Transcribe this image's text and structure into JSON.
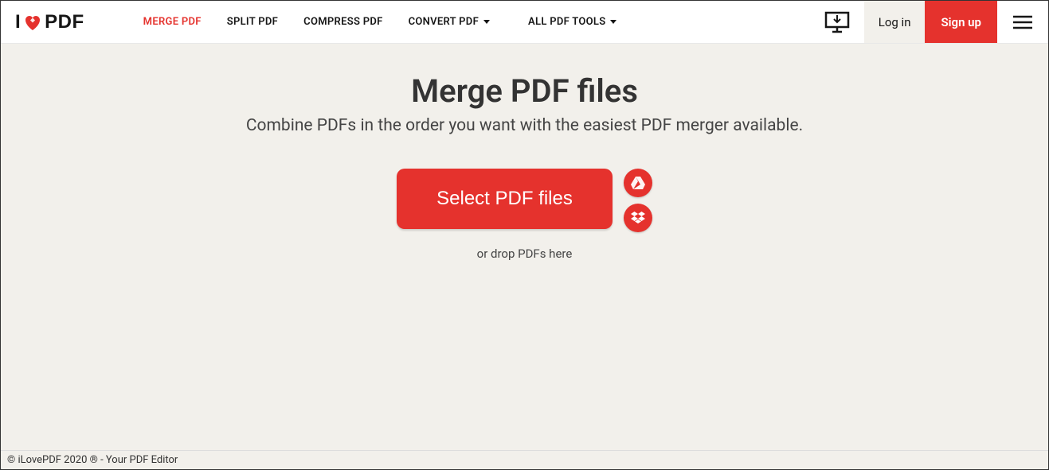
{
  "logo": {
    "prefix": "I",
    "suffix": "PDF"
  },
  "nav": {
    "merge": "MERGE PDF",
    "split": "SPLIT PDF",
    "compress": "COMPRESS PDF",
    "convert": "CONVERT PDF",
    "all": "ALL PDF TOOLS"
  },
  "header": {
    "login": "Log in",
    "signup": "Sign up"
  },
  "main": {
    "title": "Merge PDF files",
    "subtitle": "Combine PDFs in the order you want with the easiest PDF merger available.",
    "select_button": "Select PDF files",
    "drop_text": "or drop PDFs here"
  },
  "footer": {
    "copyright": "© iLovePDF 2020 ® - Your PDF Editor"
  }
}
